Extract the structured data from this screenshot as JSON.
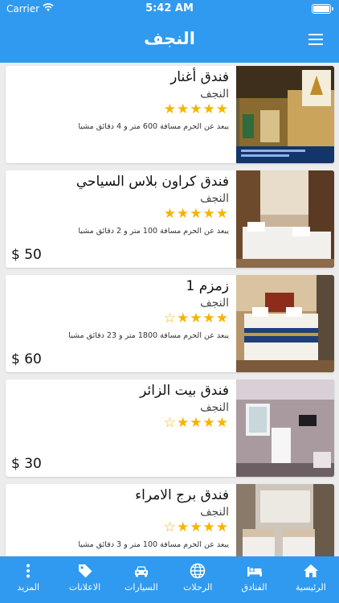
{
  "status_bar": {
    "carrier": "Carrier",
    "time": "5:42 AM"
  },
  "header": {
    "title": "النجف"
  },
  "hotels": [
    {
      "name": "فندق أغنار",
      "city": "النجف",
      "stars": "★★★★★",
      "distance": "يبعد عن الحرم مسافة 600 متر و 4 دقائق مشيا",
      "price": ""
    },
    {
      "name": "فندق كراون بلاس السياحي",
      "city": "النجف",
      "stars": "★★★★★",
      "distance": "يبعد عن الحرم مسافة 100 متر و 2 دقائق مشيا",
      "price": "$ 50"
    },
    {
      "name": "زمزم 1",
      "city": "النجف",
      "stars": "☆★★★★",
      "distance": "يبعد عن الحرم مسافة 1800 متر و 23 دقائق مشيا",
      "price": "$ 60"
    },
    {
      "name": "فندق بيت الزائر",
      "city": "النجف",
      "stars": "☆★★★★",
      "distance": "",
      "price": "$ 30"
    },
    {
      "name": "فندق برج الامراء",
      "city": "النجف",
      "stars": "☆★★★★",
      "distance": "يبعد عن الحرم مسافة 100 متر و 3 دقائق مشيا",
      "price": ""
    }
  ],
  "tabs": [
    {
      "label": "الرئيسية",
      "icon": "home-icon"
    },
    {
      "label": "الفنادق",
      "icon": "bed-icon"
    },
    {
      "label": "الرحلات",
      "icon": "globe-icon"
    },
    {
      "label": "السيارات",
      "icon": "car-icon"
    },
    {
      "label": "الاعلانات",
      "icon": "tag-icon"
    },
    {
      "label": "المزيد",
      "icon": "more-icon"
    }
  ],
  "colors": {
    "primary": "#2f9af0",
    "star": "#f6b400",
    "background": "#ececec"
  }
}
